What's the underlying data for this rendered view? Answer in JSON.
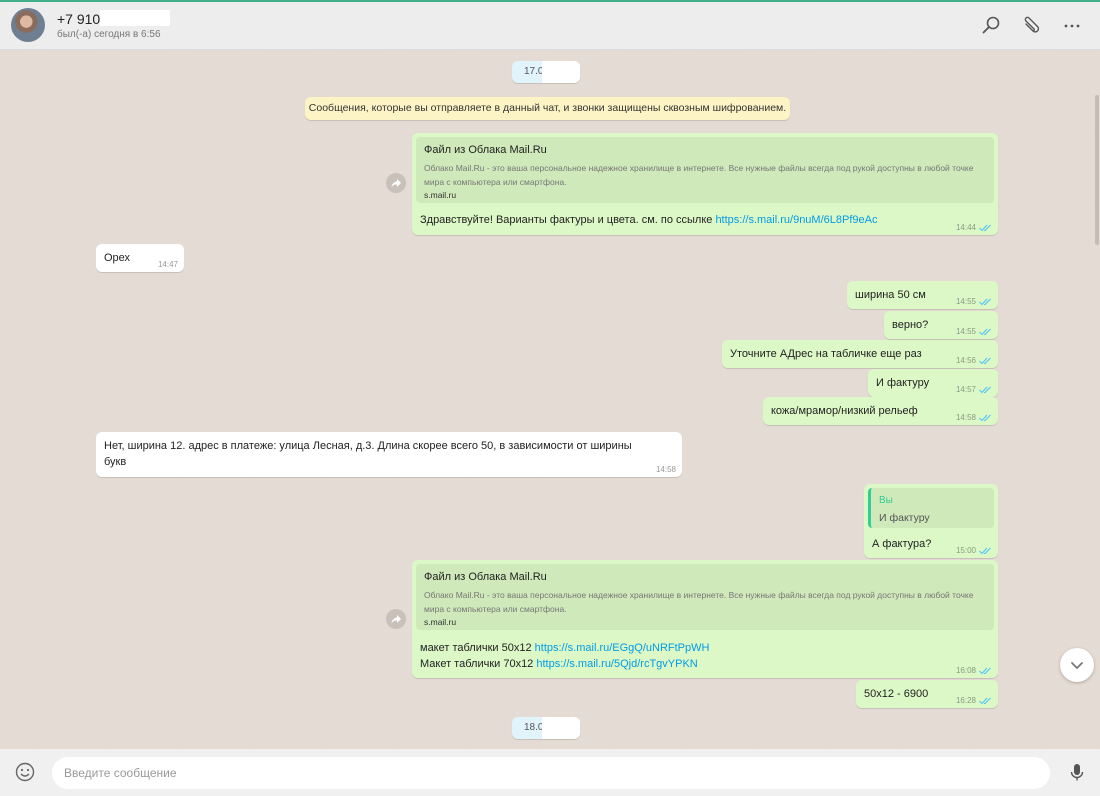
{
  "header": {
    "contact_name": "+7 910",
    "status": "был(-а) сегодня в 6:56"
  },
  "dates": [
    "17.0",
    "18.0"
  ],
  "encryption_notice": "Сообщения, которые вы отправляете в данный чат, и звонки защищены сквозным шифрованием.",
  "messages": [
    {
      "id": "m1",
      "dir": "out",
      "preview": {
        "title": "Файл из Облака Mail.Ru",
        "desc": "Облако Mail.Ru - это ваша персональное надежное хранилище в интернете. Все нужные файлы всегда под рукой доступны в любой точке мира с компьютера или смартфона.",
        "domain": "s.mail.ru"
      },
      "text": "Здравствуйте! Варианты фактуры и цвета. см. по ссылке ",
      "link": "https://s.mail.ru/9nuM/6L8Pf9eAc",
      "time": "14:44"
    },
    {
      "id": "m2",
      "dir": "in",
      "text": "Орех",
      "time": "14:47"
    },
    {
      "id": "m3",
      "dir": "out",
      "text": "ширина 50 см",
      "time": "14:55"
    },
    {
      "id": "m4",
      "dir": "out",
      "text": "верно?",
      "time": "14:55"
    },
    {
      "id": "m5",
      "dir": "out",
      "text": "Уточните АДрес на табличке еще раз",
      "time": "14:56"
    },
    {
      "id": "m6",
      "dir": "out",
      "text": "И фактуру",
      "time": "14:57"
    },
    {
      "id": "m7",
      "dir": "out",
      "text": "кожа/мрамор/низкий рельеф",
      "time": "14:58"
    },
    {
      "id": "m8",
      "dir": "in",
      "text_line1": "Нет, ширина 12. адрес в платеже: улица Лесная, д.3. Длина скорее всего 50, в зависимости от ширины",
      "text_line2": "букв",
      "time": "14:58"
    },
    {
      "id": "m9",
      "dir": "out",
      "quote_author": "Вы",
      "quote_text": "И фактуру",
      "text": "А фактура?",
      "time": "15:00"
    },
    {
      "id": "m10",
      "dir": "out",
      "preview": {
        "title": "Файл из Облака Mail.Ru",
        "desc": "Облако Mail.Ru - это ваша персональное надежное хранилище в интернете. Все нужные файлы всегда под рукой доступны в любой точке мира с компьютера или смартфона.",
        "domain": "s.mail.ru"
      },
      "line1_text": "макет таблички 50x12 ",
      "line1_link": "https://s.mail.ru/EGgQ/uNRFtPpWH",
      "line2_text": "Макет таблички 70x12 ",
      "line2_link": "https://s.mail.ru/5Qjd/rcTgvYPKN",
      "time": "16:08"
    },
    {
      "id": "m11",
      "dir": "out",
      "text": "50x12 - 6900",
      "time": "16:28"
    }
  ],
  "composer": {
    "placeholder": "Введите сообщение"
  },
  "icons": {
    "search": "search-icon",
    "attach": "paperclip-icon",
    "menu": "more-vertical-icon",
    "emoji": "emoji-icon",
    "mic": "microphone-icon",
    "scroll": "chevron-down-icon",
    "forward": "forward-icon",
    "ticks": "double-check-icon"
  },
  "colors": {
    "outgoing": "#dcf8c6",
    "incoming": "#ffffff",
    "link": "#039be5",
    "tick": "#4fc3f7",
    "accent": "#35cd96"
  }
}
